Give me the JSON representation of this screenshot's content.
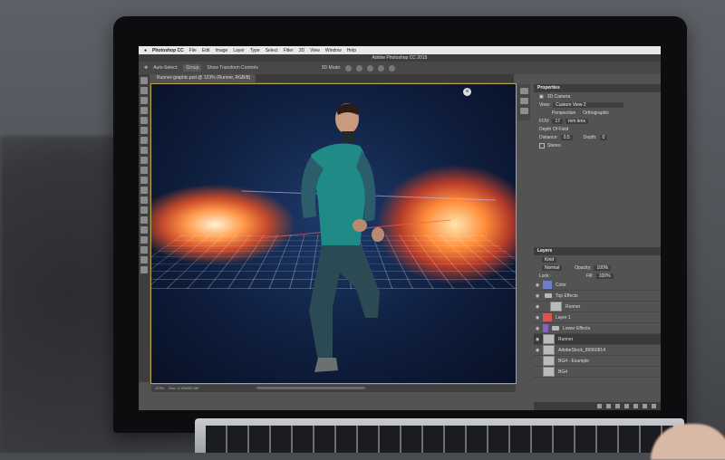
{
  "menubar": {
    "app_name": "Photoshop CC",
    "items": [
      "File",
      "Edit",
      "Image",
      "Layer",
      "Type",
      "Select",
      "Filter",
      "3D",
      "View",
      "Window",
      "Help"
    ]
  },
  "window": {
    "title": "Adobe Photoshop CC 2015"
  },
  "options": {
    "auto_select": "Auto-Select:",
    "group": "Group",
    "show_transform": "Show Transform Controls",
    "mode_3d": "3D Mode:"
  },
  "document": {
    "tab_label": "Runner-graphic.psd @ 123% (Runner, RGB/8)"
  },
  "status": {
    "zoom": "123%",
    "doc_info": "Doc: 4.12M/52.6M"
  },
  "properties": {
    "panel_title": "Properties",
    "section": "3D Camera",
    "view_label": "View:",
    "view_value": "Custom View 2",
    "perspective": "Perspective",
    "orthographic": "Orthographic",
    "fov_label": "FOV:",
    "fov_value": "17",
    "fov_unit": "mm lens",
    "depth_of_field": "Depth Of Field",
    "distance_label": "Distance:",
    "distance_value": "0.5",
    "depth_label": "Depth:",
    "depth_value": "0",
    "stereo": "Stereo"
  },
  "layers": {
    "panel_title": "Layers",
    "filter_kind": "Kind",
    "blend_mode": "Normal",
    "opacity_label": "Opacity:",
    "opacity_value": "100%",
    "lock_label": "Lock:",
    "fill_label": "Fill:",
    "fill_value": "100%",
    "items": [
      {
        "name": "Color",
        "type": "swatch",
        "color": "#6e7fc9"
      },
      {
        "name": "Top Effects",
        "type": "folder"
      },
      {
        "name": "Runner",
        "type": "thumb",
        "indent": true
      },
      {
        "name": "Layer 1",
        "type": "swatch",
        "color": "#d9534f"
      },
      {
        "name": "Lower Effects",
        "type": "folder",
        "color": "#8a63b8"
      },
      {
        "name": "Runner",
        "type": "thumb",
        "selected": true
      },
      {
        "name": "AdobeStock_89960814",
        "type": "thumb"
      },
      {
        "name": "BG4 - Example",
        "type": "thumb"
      },
      {
        "name": "BG4",
        "type": "thumb"
      }
    ]
  }
}
